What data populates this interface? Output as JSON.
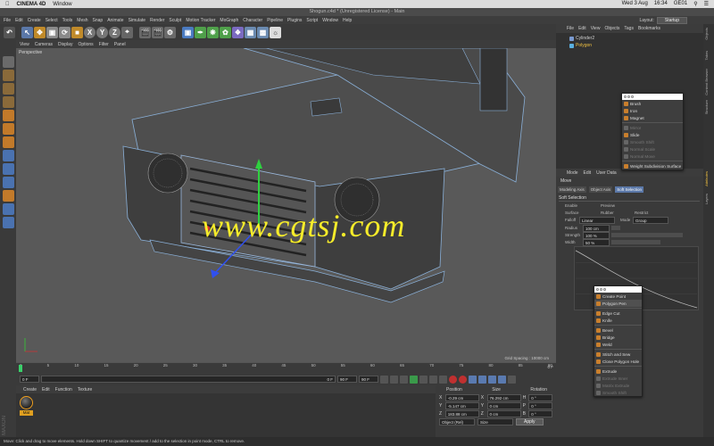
{
  "mac_bar": {
    "app": "CINEMA 4D",
    "menu": "Window",
    "date": "Wed 3 Aug",
    "time": "16:34",
    "user": "GE01"
  },
  "title": "Shogun.c4d * (Unregistered License) - Main",
  "menu": [
    "File",
    "Edit",
    "Create",
    "Select",
    "Tools",
    "Mesh",
    "Snap",
    "Animate",
    "Simulate",
    "Render",
    "Sculpt",
    "Motion Tracker",
    "MoGraph",
    "Character",
    "Pipeline",
    "Plugins",
    "Script",
    "Window",
    "Help"
  ],
  "layout": {
    "label": "Layout:",
    "value": "Startup"
  },
  "toolbar": {
    "axis_x": "X",
    "axis_y": "Y",
    "axis_z": "Z"
  },
  "viewport": {
    "menu": [
      "View",
      "Cameras",
      "Display",
      "Options",
      "Filter",
      "Panel"
    ],
    "label": "Perspective",
    "grid_spacing": "Grid Spacing : 10000 cm",
    "watermark": "www.cgtsj.com"
  },
  "timeline": {
    "ticks": [
      "0",
      "5",
      "10",
      "15",
      "20",
      "25",
      "30",
      "35",
      "40",
      "45",
      "50",
      "55",
      "60",
      "65",
      "70",
      "75",
      "80",
      "85",
      "90"
    ],
    "end": "0 F"
  },
  "transport": {
    "start": "0 F",
    "current": "0 F",
    "end": "90 F",
    "max": "90 F"
  },
  "materials": {
    "menu": [
      "Create",
      "Edit",
      "Function",
      "Texture"
    ],
    "item": "Mat"
  },
  "coords": {
    "headers": [
      "Position",
      "Size",
      "Rotation"
    ],
    "rows": [
      {
        "axis": "X",
        "pos": "-0.29 cm",
        "size": "76.292 cm",
        "rot_axis": "H",
        "rot": "0 °"
      },
      {
        "axis": "Y",
        "pos": "-5.147 cm",
        "size": "0 cm",
        "rot_axis": "P",
        "rot": "0 °"
      },
      {
        "axis": "Z",
        "pos": "183.88 cm",
        "size": "0 cm",
        "rot_axis": "B",
        "rot": "0 °"
      }
    ],
    "mode": "Object (Rel)",
    "size_mode": "Size",
    "apply": "Apply"
  },
  "status": "Move: Click and drag to move elements. Hold down SHIFT to quantize movement / add to the selection in point mode, CTRL to remove.",
  "objects": {
    "menu": [
      "File",
      "Edit",
      "View",
      "Objects",
      "Tags",
      "Bookmarks"
    ],
    "items": [
      {
        "name": "Cylinder2",
        "color": "#cfcfcf"
      },
      {
        "name": "Polygon",
        "color": "#f0c040"
      }
    ]
  },
  "attributes": {
    "menu": [
      "Mode",
      "Edit",
      "User Data"
    ],
    "title": "Move",
    "tabs": [
      "Modeling Axis",
      "Object Axis",
      "Soft Selection"
    ],
    "section": "Soft Selection",
    "rows": [
      {
        "label": "Enable",
        "value": "Preview"
      },
      {
        "label": "Surface",
        "value": "Rubber"
      },
      {
        "label": "Falloff",
        "value": "Linear"
      },
      {
        "label": "Radius",
        "value": "100 cm"
      },
      {
        "label": "Strength",
        "value": "100 %"
      },
      {
        "label": "Width",
        "value": "50 %"
      }
    ],
    "restrict": "Restrict",
    "mode": "Mode",
    "mode_value": "Group"
  },
  "popup1": {
    "items": [
      "Brush",
      "Iron",
      "Magnet",
      "Mirror",
      "Slide",
      "Smooth Shift",
      "Normal Scale",
      "Normal Move",
      "Weight Subdivision Surface"
    ],
    "dim": [
      3,
      5,
      6,
      7
    ]
  },
  "popup2": {
    "items": [
      "Create Point",
      "Polygon Pen",
      "Edge Cut",
      "Knife",
      "Bevel",
      "Bridge",
      "Weld",
      "Stitch and Sew",
      "Close Polygon Hole",
      "Extrude",
      "Extrude Inner",
      "Matrix Extrude",
      "Smooth Shift"
    ],
    "dim": [
      10,
      11,
      12
    ],
    "selected": 1
  },
  "side_tabs": [
    "Objects",
    "Takes",
    "Content Browser",
    "Structure",
    "Attributes",
    "Layers"
  ],
  "colors": {
    "accent": "#5b78a8",
    "highlight": "#f0c040",
    "watermark": "#f6ec2a"
  }
}
